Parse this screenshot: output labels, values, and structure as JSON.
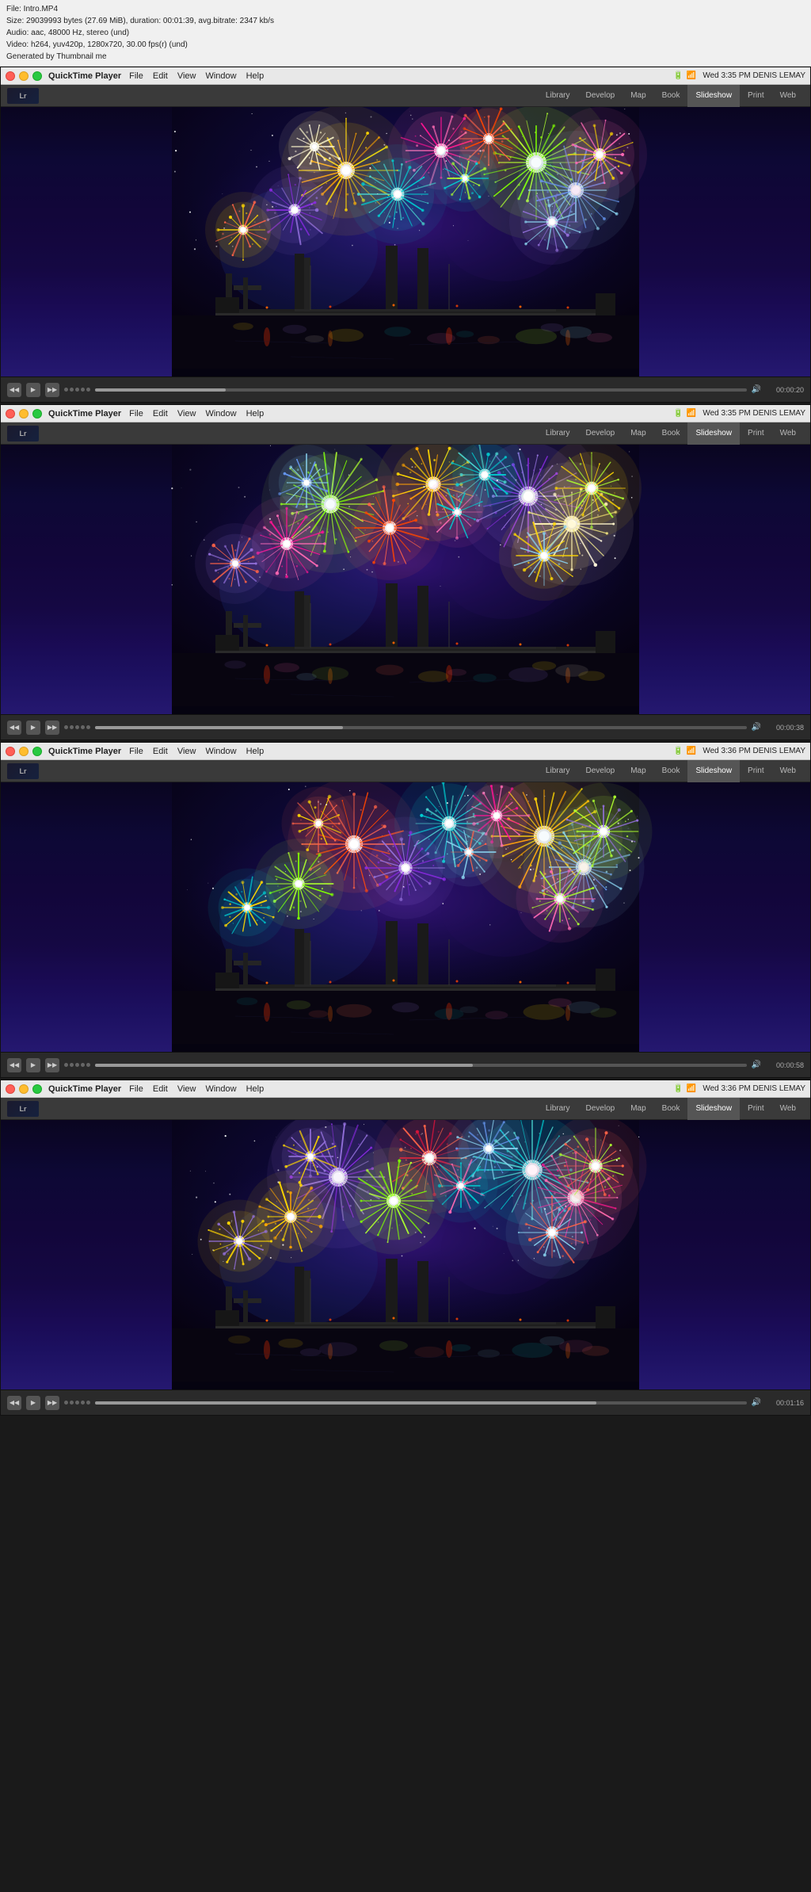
{
  "file_info": {
    "line1": "File: Intro.MP4",
    "line2": "Size: 29039993 bytes (27.69 MiB), duration: 00:01:39, avg.bitrate: 2347 kb/s",
    "line3": "Audio: aac, 48000 Hz, stereo (und)",
    "line4": "Video: h264, yuv420p, 1280x720, 30.00 fps(r) (und)",
    "line5": "Generated by Thumbnail me"
  },
  "windows": [
    {
      "id": "window1",
      "app_name": "QuickTime Player",
      "menu_items": [
        "File",
        "Edit",
        "View",
        "Window",
        "Help"
      ],
      "right_status": "Wed 3:35 PM  DENIS LEMAY",
      "lr_tabs": [
        "Library",
        "Develop",
        "Map",
        "Book",
        "Slideshow",
        "Print",
        "Web"
      ],
      "active_tab": "Slideshow",
      "timestamp": "00:00:20",
      "progress_pct": 20
    },
    {
      "id": "window2",
      "app_name": "QuickTime Player",
      "menu_items": [
        "File",
        "Edit",
        "View",
        "Window",
        "Help"
      ],
      "right_status": "Wed 3:35 PM  DENIS LEMAY",
      "lr_tabs": [
        "Library",
        "Develop",
        "Map",
        "Book",
        "Slideshow",
        "Print",
        "Web"
      ],
      "active_tab": "Slideshow",
      "timestamp": "00:00:38",
      "progress_pct": 38
    },
    {
      "id": "window3",
      "app_name": "QuickTime Player",
      "menu_items": [
        "File",
        "Edit",
        "View",
        "Window",
        "Help"
      ],
      "right_status": "Wed 3:36 PM  DENIS LEMAY",
      "lr_tabs": [
        "Library",
        "Develop",
        "Map",
        "Book",
        "Slideshow",
        "Print",
        "Web"
      ],
      "active_tab": "Slideshow",
      "timestamp": "00:00:58",
      "progress_pct": 58
    },
    {
      "id": "window4",
      "app_name": "QuickTime Player",
      "menu_items": [
        "File",
        "Edit",
        "View",
        "Window",
        "Help"
      ],
      "right_status": "Wed 3:36 PM  DENIS LEMAY",
      "lr_tabs": [
        "Library",
        "Develop",
        "Map",
        "Book",
        "Slideshow",
        "Print",
        "Web"
      ],
      "active_tab": "Slideshow",
      "timestamp": "00:01:16",
      "progress_pct": 77
    }
  ],
  "controls": {
    "play_label": "▶",
    "rewind_label": "◀◀",
    "ff_label": "▶▶",
    "volume_icon": "🔊"
  }
}
